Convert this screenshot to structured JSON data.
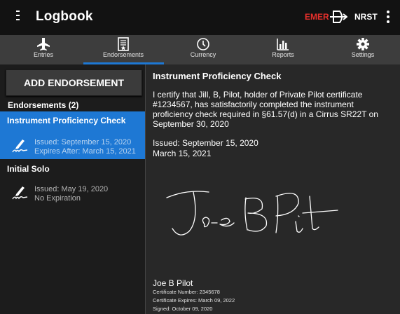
{
  "app": {
    "title": "Logbook",
    "emer_label": "EMER",
    "nrst_label": "NRST"
  },
  "tabs": [
    {
      "label": "Entries",
      "icon": "airplane-icon"
    },
    {
      "label": "Endorsements",
      "icon": "document-icon"
    },
    {
      "label": "Currency",
      "icon": "clock-icon"
    },
    {
      "label": "Reports",
      "icon": "bar-chart-icon"
    },
    {
      "label": "Settings",
      "icon": "gear-icon"
    }
  ],
  "active_tab": "Endorsements",
  "colors": {
    "accent": "#1e78d4",
    "emer": "#e8302c",
    "background": "#262626"
  },
  "sidebar": {
    "add_button": "ADD ENDORSEMENT",
    "header": "Endorsements (2)",
    "items": [
      {
        "title": "Instrument Proficiency Check",
        "line1": "Issued: September 15, 2020",
        "line2": "Expires After: March 15, 2021",
        "selected": true
      },
      {
        "title": "Initial Solo",
        "line1": "Issued: May 19, 2020",
        "line2": "No Expiration",
        "selected": false
      }
    ]
  },
  "detail": {
    "title": "Instrument Proficiency Check",
    "body": "I certify that Jill, B, Pilot, holder of Private Pilot certificate #1234567, has satisfactorily completed the instrument proficiency check required in §61.57(d) in a Cirrus SR22T on September 30, 2020",
    "issued": "Issued: September 15, 2020",
    "expires": "March 15, 2021",
    "signer_name": "Joe B Pilot",
    "certificate_number": "Certificate Number: 2345678",
    "certificate_expires": "Certificate Expires: March 09, 2022",
    "signed": "Signed: October 09, 2020"
  }
}
